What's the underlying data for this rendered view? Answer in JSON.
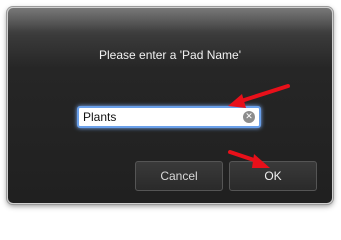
{
  "dialog": {
    "prompt": "Please enter a 'Pad Name'",
    "input_value": "Plants",
    "cancel_label": "Cancel",
    "ok_label": "OK"
  },
  "icons": {
    "clear": "clear-icon",
    "annotation": "red-arrow-icon"
  },
  "colors": {
    "arrow": "#e8101a",
    "focus_ring": "#6aa0ea",
    "dialog_bg": "#262626"
  }
}
